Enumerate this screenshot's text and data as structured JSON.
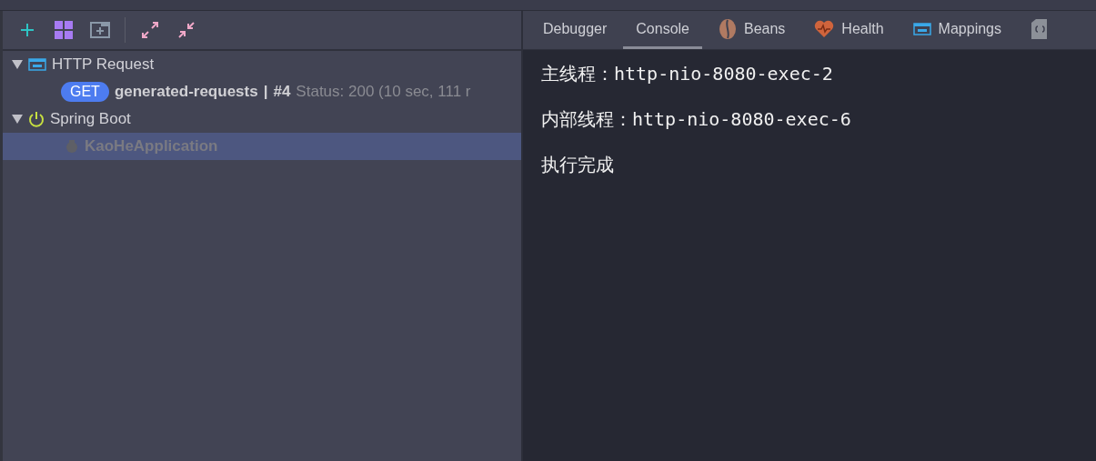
{
  "toolbar": [
    {
      "kind": "add"
    },
    {
      "kind": "grid"
    },
    {
      "kind": "new-window"
    },
    {
      "kind": "expand"
    },
    {
      "kind": "collapse"
    }
  ],
  "tree": [
    {
      "kind": "http",
      "label": "HTTP Request",
      "expanded": true,
      "children": [
        {
          "kind": "request",
          "method": "GET",
          "name": "generated-requests",
          "separator": "|",
          "number": "#4",
          "status": "Status: 200 (10 sec, 111 r",
          "selected": false
        }
      ]
    },
    {
      "kind": "spring",
      "label": "Spring Boot",
      "expanded": true,
      "children": [
        {
          "kind": "app",
          "name": "KaoHeApplication",
          "selected": true
        }
      ]
    }
  ],
  "tabs": [
    {
      "kind": "plain",
      "label": "Debugger",
      "selected": false
    },
    {
      "kind": "plain",
      "label": "Console",
      "selected": true
    },
    {
      "kind": "bean",
      "label": "Beans",
      "selected": false
    },
    {
      "kind": "heart",
      "label": "Health",
      "selected": false
    },
    {
      "kind": "api",
      "label": "Mappings",
      "selected": false
    },
    {
      "kind": "config",
      "selected": false
    }
  ],
  "console": [
    "主线程：http-nio-8080-exec-2",
    "内部线程：http-nio-8080-exec-6",
    "执行完成"
  ]
}
